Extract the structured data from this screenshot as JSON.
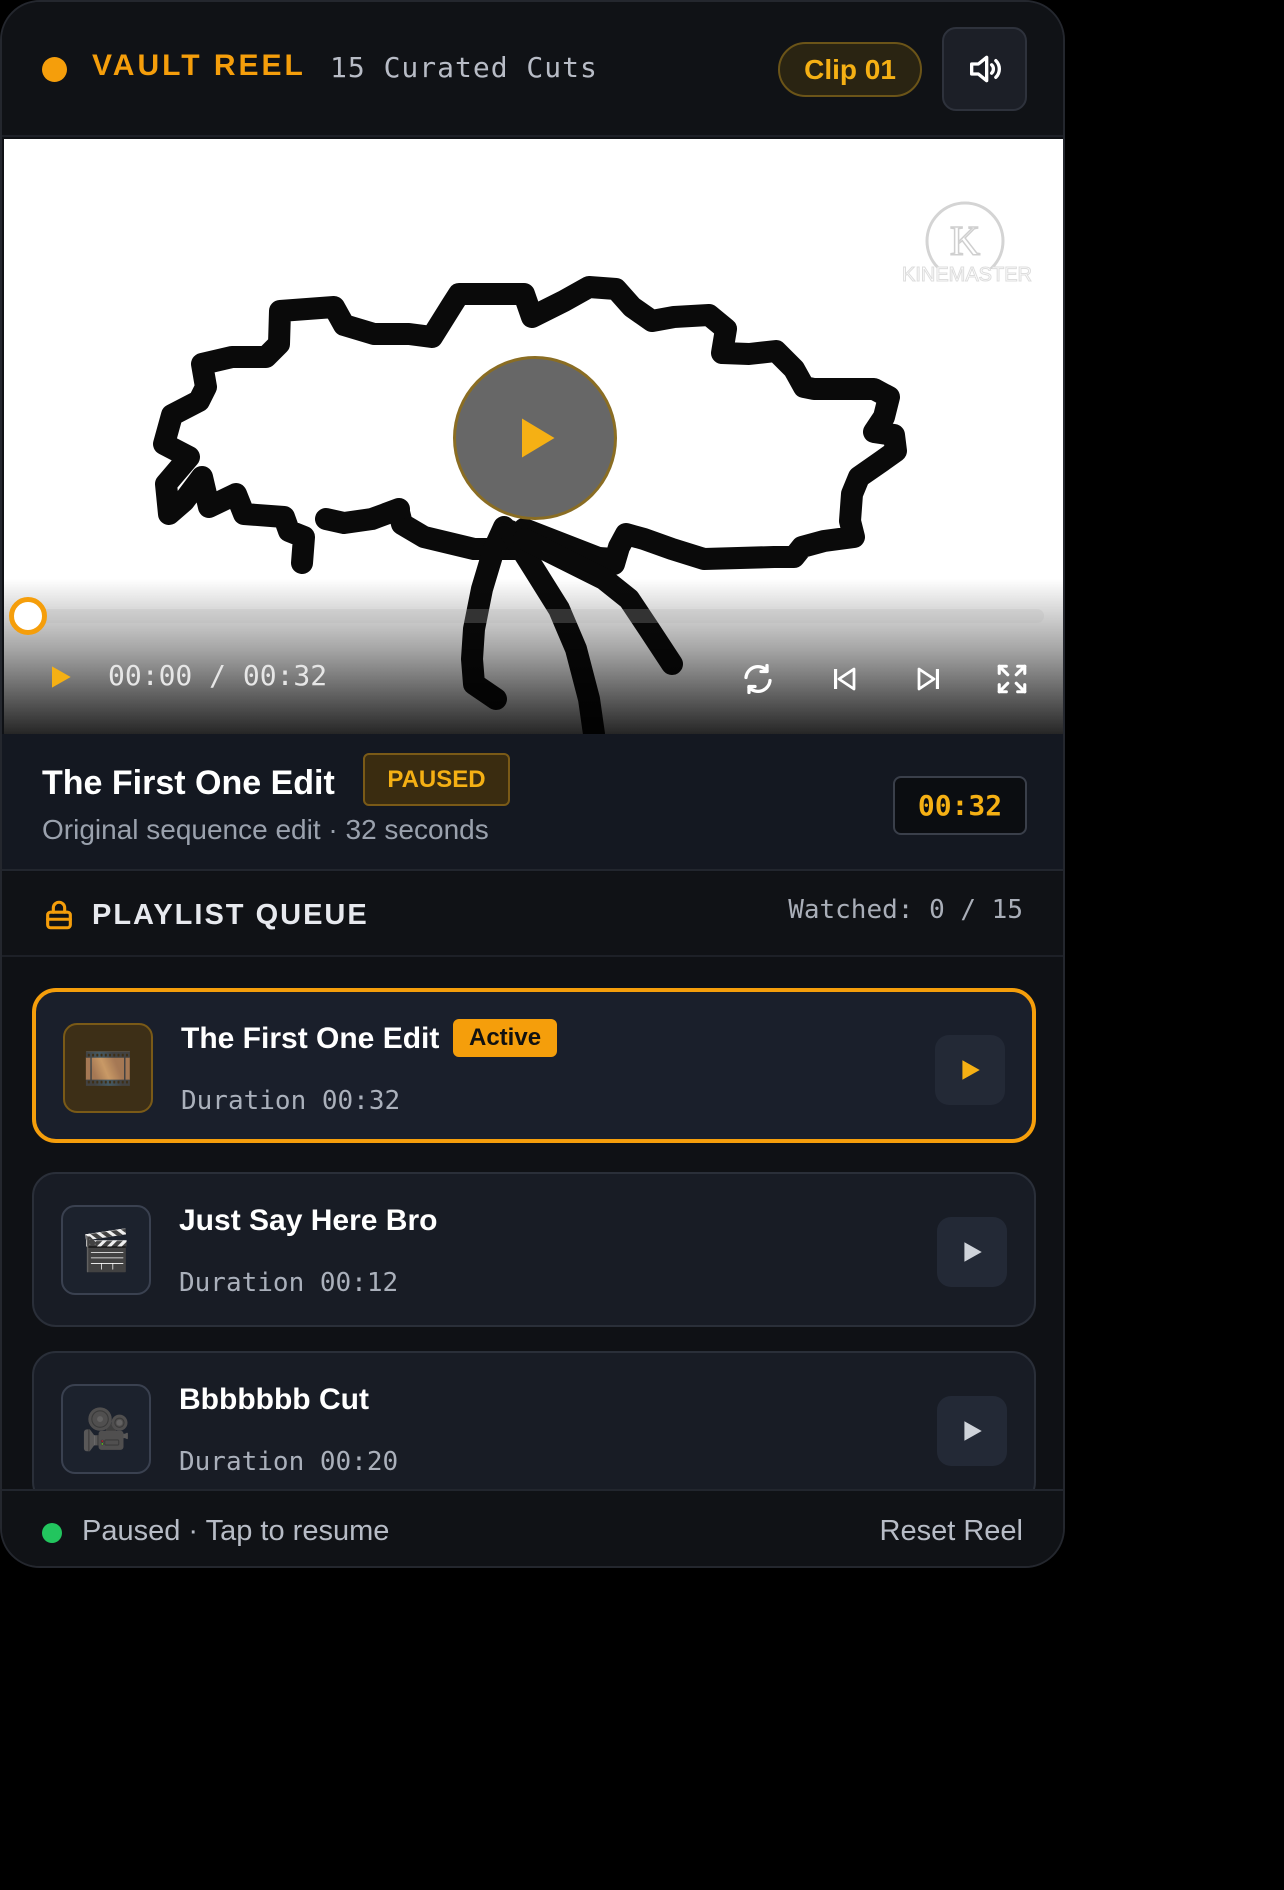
{
  "header": {
    "brand": "VAULT REEL",
    "subtitle": "15 Curated Cuts",
    "clip_pill": "Clip 01",
    "volume_icon": "speaker-icon"
  },
  "video": {
    "watermark": "KINEMASTER",
    "time_current": "00:00",
    "time_total": "00:32",
    "timecode": "00:00 / 00:32",
    "progress": 0.0,
    "controls": [
      "play-icon",
      "replay-icon",
      "skip-previous-icon",
      "skip-next-icon",
      "fullscreen-icon"
    ]
  },
  "info": {
    "title": "The First One Edit",
    "state_badge": "PAUSED",
    "description": "Original sequence edit · 32 seconds",
    "timer": "00:32"
  },
  "playlist": {
    "heading": "PLAYLIST QUEUE",
    "watched": "Watched: 0 / 15",
    "items": [
      {
        "title": "The First One Edit",
        "badge": "Active",
        "duration": "Duration 00:32",
        "thumb": "🎞️",
        "icon": "film-projector-icon"
      },
      {
        "title": "Just Say Here Bro",
        "duration": "Duration 00:12",
        "thumb": "🎬",
        "icon": "clapperboard-icon"
      },
      {
        "title": "Bbbbbbb Cut",
        "duration": "Duration 00:20",
        "thumb": "🎥",
        "icon": "movie-camera-icon"
      }
    ]
  },
  "footer": {
    "status": "Paused · Tap to resume",
    "reset": "Reset Reel"
  },
  "colors": {
    "accent": "#f59e0b",
    "background": "#0f1115",
    "status_green": "#22c55e"
  }
}
